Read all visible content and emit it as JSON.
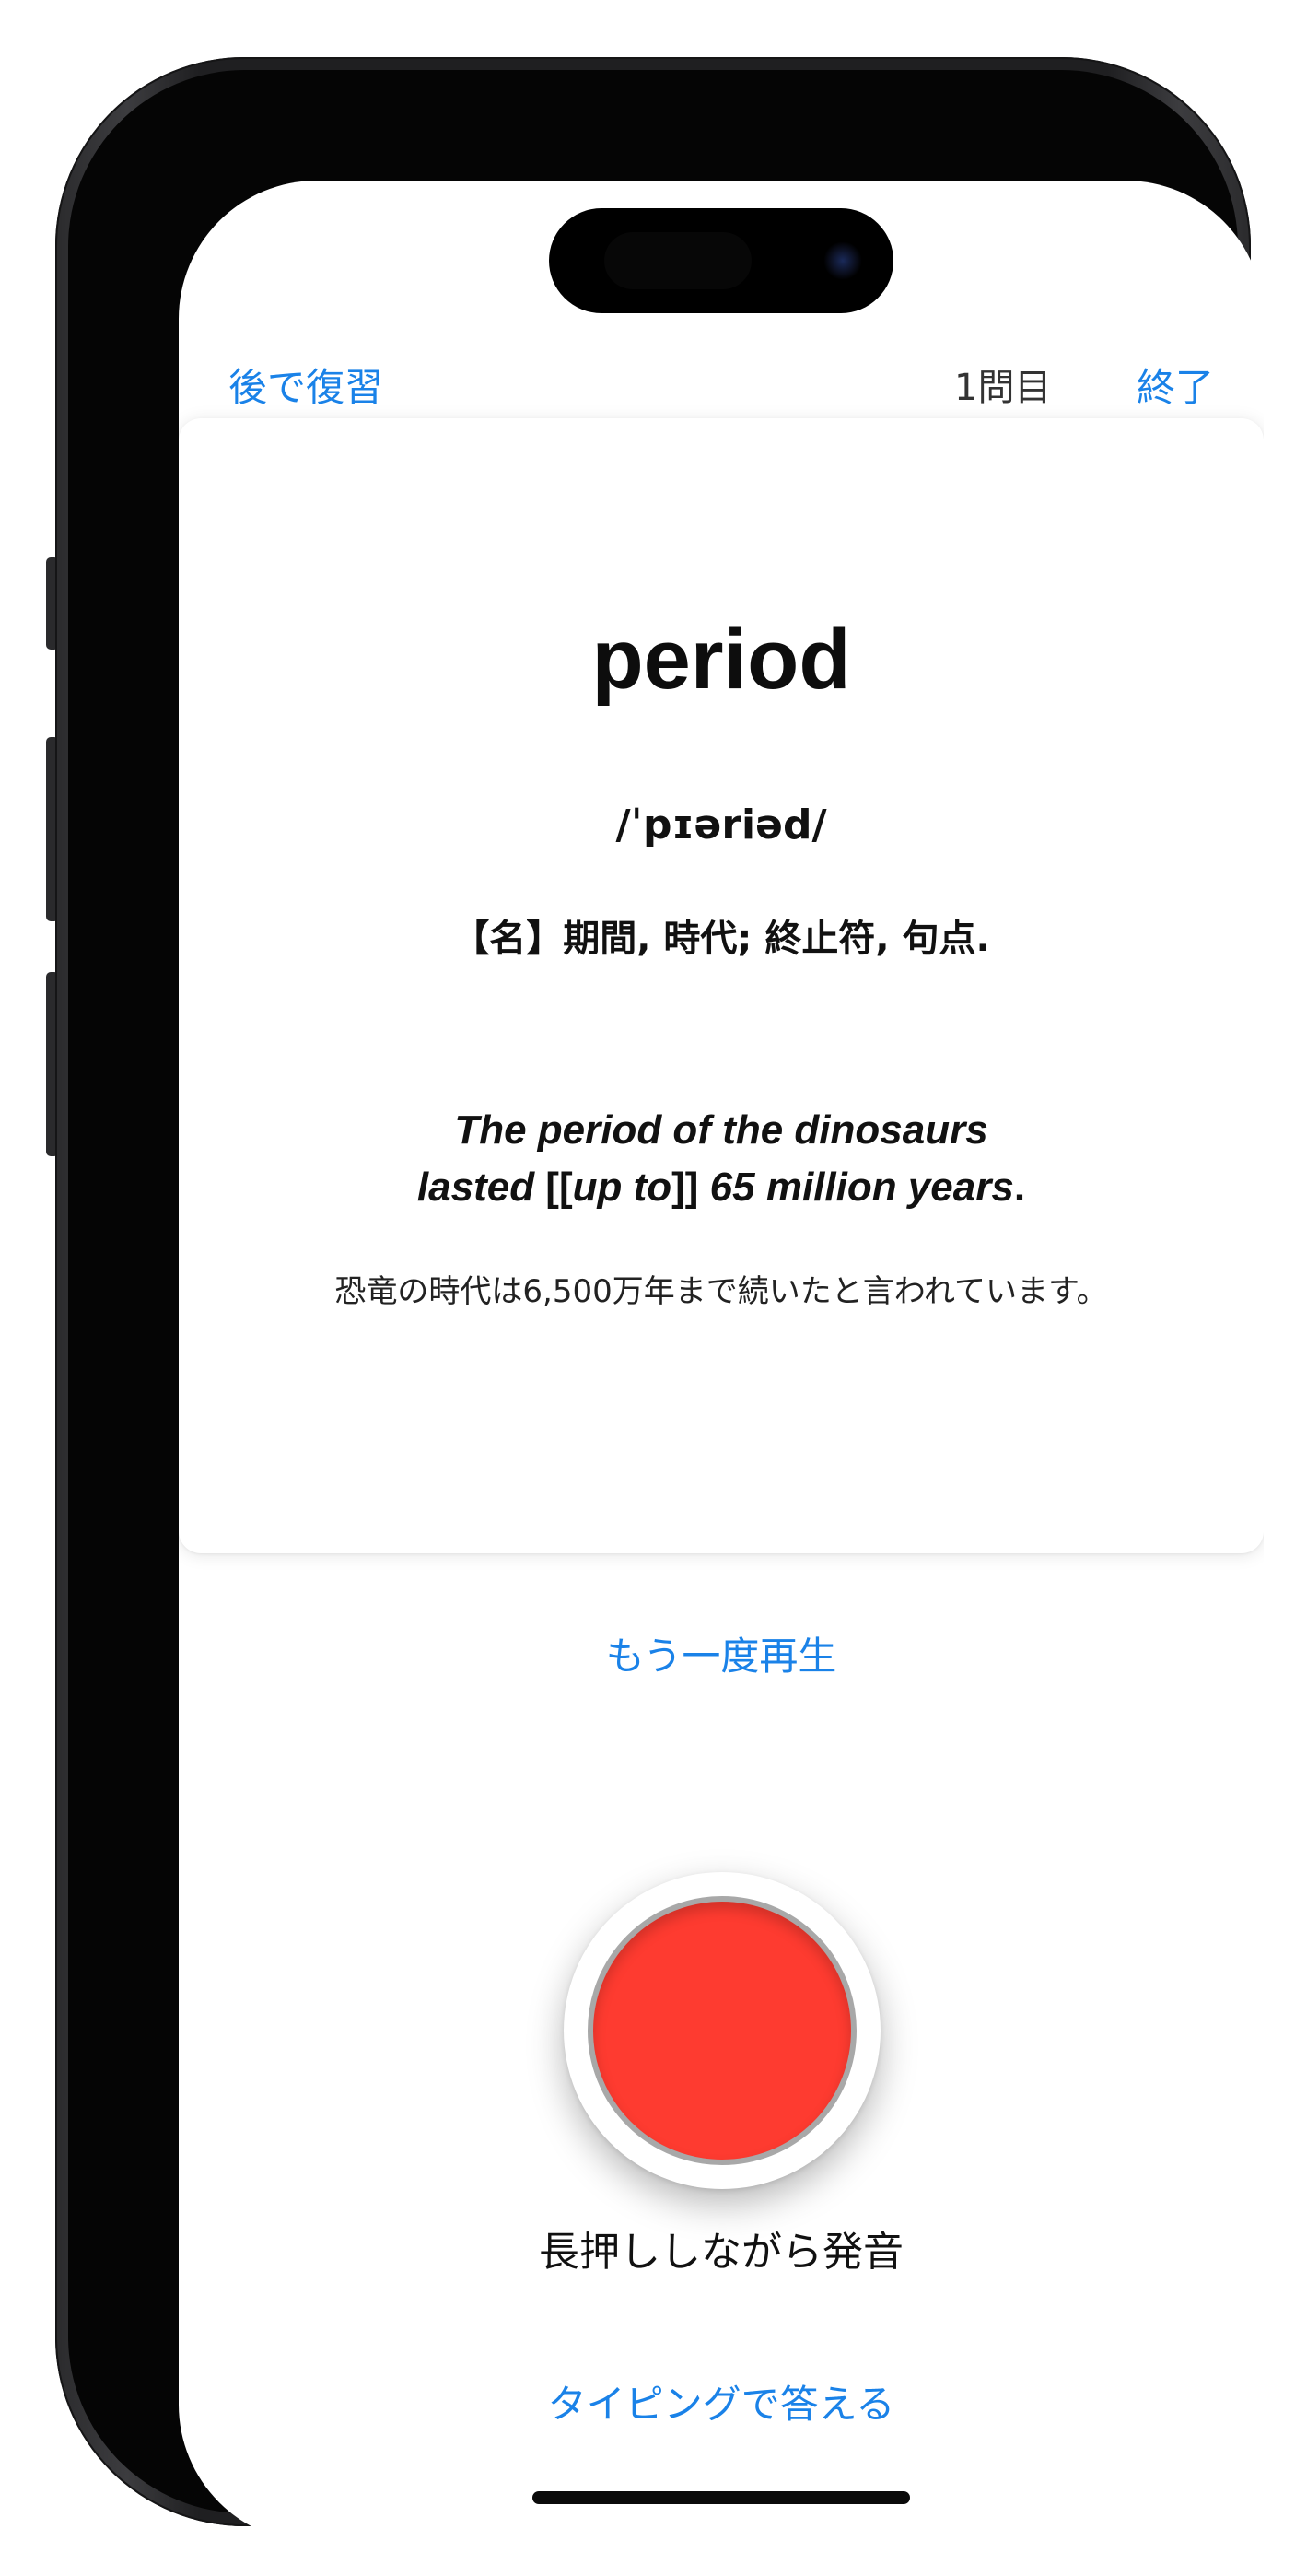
{
  "nav": {
    "review_later": "後で復習",
    "question_count": "1問目",
    "finish": "終了"
  },
  "card": {
    "word": "period",
    "pronunciation": "/ˈpɪəriəd/",
    "meaning": "【名】期間, 時代; 終止符, 句点.",
    "example_en_line1": "The period of the dinosaurs",
    "example_en_line2_a": "lasted ",
    "example_en_line2_b": "[[",
    "example_en_line2_c": "up to",
    "example_en_line2_d": "]]",
    "example_en_line2_e": " 65 million years",
    "example_en_line2_f": ".",
    "example_ja": "恐竜の時代は6,500万年まで続いたと言われています。"
  },
  "actions": {
    "replay": "もう一度再生",
    "hold_to_speak": "長押ししながら発音",
    "answer_by_typing": "タイピングで答える"
  },
  "colors": {
    "link": "#1a82e8",
    "record": "#fe3b30"
  }
}
